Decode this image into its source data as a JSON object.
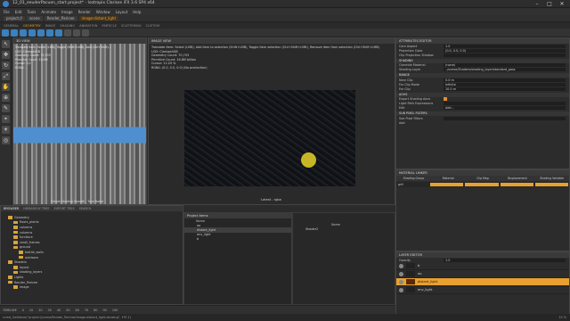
{
  "window": {
    "title": "12_01_eeuderPacuen_start.project* - Isotropix Clarisse iFX 3.6 SP4 x64",
    "controls": [
      "–",
      "□",
      "✕"
    ]
  },
  "menu": [
    "File",
    "Edit",
    "Tools",
    "Animate",
    "Image",
    "Render",
    "Window",
    "Layout",
    "Help"
  ],
  "breadcrumb": {
    "items": [
      "project://",
      "scene",
      "Render_Paricee"
    ],
    "active": "image:distant_light"
  },
  "workspace_tabs": {
    "items": [
      "GENERAL",
      "GEOMETRY",
      "IMAGE",
      "SHADING",
      "ANIMATION",
      "PARTICLE",
      "SCATTERING",
      "CUSTOM"
    ],
    "selected": "GEOMETRY"
  },
  "viewport_3d": {
    "header": "3D VIEW",
    "overlay_lines": [
      "Translate Item: Select (LMB), Toggle (Shift+LMB), Add (Ctrl+Shift)...",
      "LOD: Clarisse4GB",
      "Geometry Count: 70,703",
      "Primitive Count: 16.8M",
      "Cursor: 0,0",
      "RGBA: -"
    ],
    "footer": "Simple Shading  Smooth  -  Tone Name"
  },
  "image_view": {
    "header": "IMAGE VIEW",
    "info_lines": [
      "Translate Item: Select (LMB), Add item to selection (Shift+LMB), Toggle item selection (Ctrl+Shift+LMB), Remove item from selection (Ctrl+Shift+LMB)",
      "LOD: Clarisse4GB",
      "Geometry Count: 70,703",
      "Primitive Count: 16.8M billion",
      "Cursor: 11:20 %",
      "RGBA: (0.0, 0.0, 0.0) (No production)"
    ],
    "label": "Latest - rgba"
  },
  "attribute_editor": {
    "header": "ATTRIBUTES EDITOR",
    "top_rows": [
      {
        "label": "Cam Aspect",
        "value": "1.0"
      },
      {
        "label": "Projection Color",
        "value": "(0.0, 0.0, 0.0)"
      },
      {
        "label": "Clip Projection Shadow",
        "value": ""
      }
    ],
    "sections": [
      {
        "title": "SHADING",
        "rows": [
          {
            "label": "Override Material",
            "value": "(none)"
          },
          {
            "label": "Shading Layer",
            "value": "../scene/Shaders/shading_layer/standard_pass"
          }
        ]
      },
      {
        "title": "RANGE",
        "rows": [
          {
            "label": "Near Clip",
            "value": "0.0 m"
          },
          {
            "label": "Far Clip Mode",
            "value": "Infinite"
          },
          {
            "label": "Far Clip",
            "value": "10.0 m"
          }
        ]
      },
      {
        "title": "AOVS",
        "rows": [
          {
            "label": "Export Shading Aovs",
            "value": "☑"
          },
          {
            "label": "Light Path Expressions",
            "value": ""
          },
          {
            "label": "Edit",
            "value": "Add..."
          }
        ]
      },
      {
        "title": "SUB PIXEL FILTERS",
        "rows": [
          {
            "label": "Sub Pixel Filters",
            "value": ""
          },
          {
            "label": "Add",
            "value": ""
          }
        ]
      }
    ]
  },
  "material_linker": {
    "header": "MATERIAL LINKER",
    "columns": [
      "Shading Group",
      "Material",
      "Clip Map",
      "Displacement",
      "Shading Variable"
    ],
    "rows": [
      {
        "group": "grill",
        "material": "",
        "clip": "",
        "disp": "",
        "var": ""
      }
    ]
  },
  "layer_editor": {
    "header": "LAYER EDITOR",
    "toolbar_label": "Opacity",
    "opacity": "1.0",
    "layers": [
      {
        "name": "b",
        "selected": false
      },
      {
        "name": "ao",
        "selected": false
      },
      {
        "name": "distant_light",
        "selected": true
      },
      {
        "name": "env_light",
        "selected": false
      }
    ]
  },
  "browser": {
    "tabs": [
      "BROWSER",
      "HIERARCHY TREE",
      "EXPORT TREE",
      "SEARCH"
    ],
    "selected_tab": "BROWSER",
    "tree": [
      {
        "label": "Geometry",
        "indent": 1
      },
      {
        "label": "floors_plants",
        "indent": 2
      },
      {
        "label": "columns",
        "indent": 2
      },
      {
        "label": "columns",
        "indent": 2
      },
      {
        "label": "furniture",
        "indent": 2
      },
      {
        "label": "small_frames",
        "indent": 2
      },
      {
        "label": "ground",
        "indent": 2
      },
      {
        "label": "textile_walls",
        "indent": 3
      },
      {
        "label": "outdoors",
        "indent": 3
      },
      {
        "label": "Shaders",
        "indent": 1
      },
      {
        "label": "layout",
        "indent": 2
      },
      {
        "label": "shading_layers",
        "indent": 2
      },
      {
        "label": "Lights",
        "indent": 1
      },
      {
        "label": "Render_Paricee",
        "indent": 1
      },
      {
        "label": "image",
        "indent": 2
      }
    ]
  },
  "file_list": {
    "header": "Project Items",
    "column": "Name",
    "items": [
      {
        "name": "ao",
        "selected": false
      },
      {
        "name": "distant_light",
        "selected": true
      },
      {
        "name": "env_light",
        "selected": false
      },
      {
        "name": "b",
        "selected": false
      }
    ]
  },
  "mid_panel": {
    "column": "Name",
    "items": [
      "Shader2"
    ]
  },
  "timeline": {
    "label": "TIMELINE",
    "frames": [
      "0",
      "10",
      "20",
      "30",
      "40",
      "50",
      "60",
      "70",
      "80",
      "90",
      "100"
    ]
  },
  "status_bar": {
    "left": "ccmd_GetValue(\"project://scene/Render_Paricee/image.distant_light.densing\", 1*0 1)",
    "right": "15 %"
  }
}
